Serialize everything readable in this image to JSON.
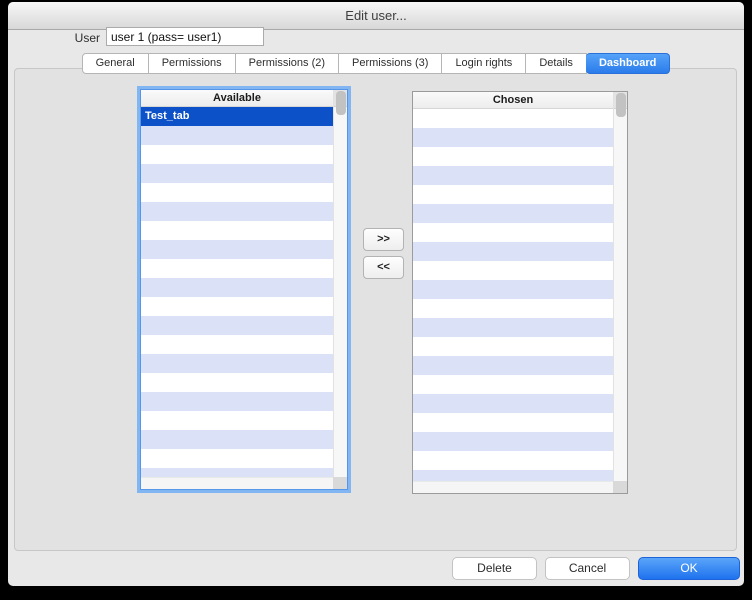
{
  "window": {
    "title": "Edit user..."
  },
  "user_field": {
    "label": "User",
    "value": "user 1 (pass= user1)"
  },
  "tabs": [
    {
      "label": "General",
      "selected": false
    },
    {
      "label": "Permissions",
      "selected": false
    },
    {
      "label": "Permissions (2)",
      "selected": false
    },
    {
      "label": "Permissions (3)",
      "selected": false
    },
    {
      "label": "Login rights",
      "selected": false
    },
    {
      "label": "Details",
      "selected": false
    },
    {
      "label": "Dashboard",
      "selected": true
    }
  ],
  "available_list": {
    "header": "Available",
    "items": [
      {
        "label": "Test_tab",
        "selected": true
      }
    ]
  },
  "chosen_list": {
    "header": "Chosen",
    "items": []
  },
  "transfer_buttons": {
    "move_right": ">>",
    "move_left": "<<"
  },
  "footer_buttons": {
    "delete": "Delete",
    "cancel": "Cancel",
    "ok": "OK"
  },
  "colors": {
    "selection_blue": "#0d51c9",
    "alt_row_lavender": "#dbe2f8",
    "accent_blue": "#2a7ceb",
    "focus_ring": "#82b6f3",
    "window_bg": "#e8e8e8"
  }
}
